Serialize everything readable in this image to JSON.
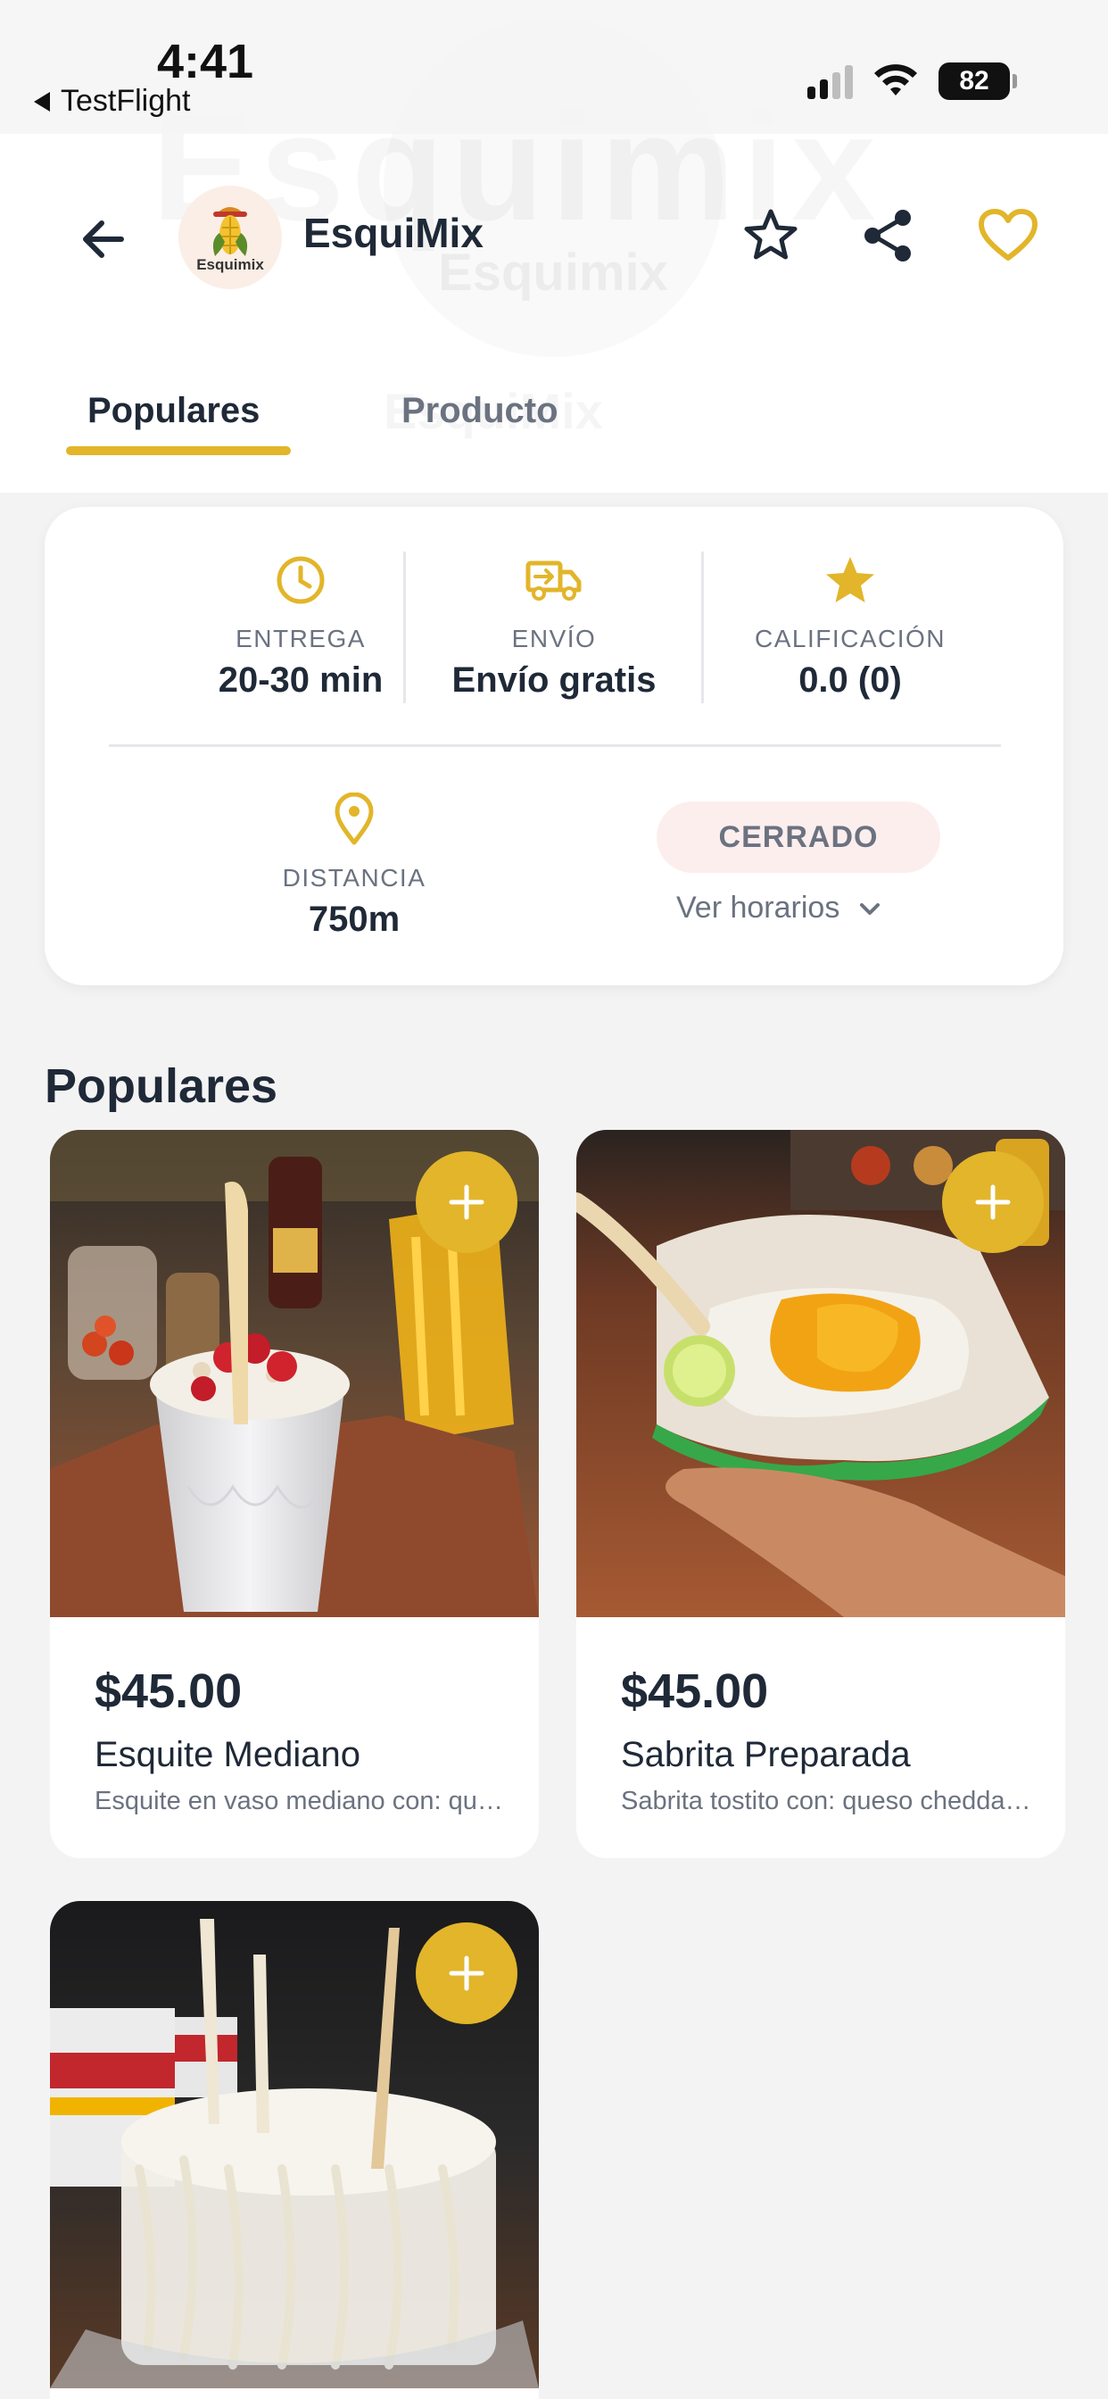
{
  "status_bar": {
    "time": "4:41",
    "back_app": "TestFlight",
    "battery": "82",
    "icons": [
      "signal-icon",
      "wifi-icon",
      "battery-icon"
    ]
  },
  "watermark": {
    "banner_word": "Esquimix",
    "logo_text": "Esquimix",
    "brand": "EsquiMix"
  },
  "header": {
    "store_name": "EsquiMix",
    "logo_text": "Esquimix",
    "icons": [
      "back-arrow-icon",
      "star-outline-icon",
      "share-icon",
      "heart-outline-icon"
    ]
  },
  "tabs": [
    {
      "label": "Populares",
      "active": true
    },
    {
      "label": "Producto",
      "active": false
    }
  ],
  "info": {
    "delivery_time": {
      "label": "ENTREGA",
      "value": "20-30 min",
      "icon": "clock-icon"
    },
    "shipping": {
      "label": "ENVÍO",
      "value": "Envío gratis",
      "icon": "delivery-truck-icon"
    },
    "rating": {
      "label": "CALIFICACIÓN",
      "value": "0.0 (0)",
      "icon": "star-filled-icon"
    },
    "distance": {
      "label": "DISTANCIA",
      "value": "750m",
      "icon": "location-pin-icon"
    },
    "status": "CERRADO",
    "hours_link": "Ver horarios"
  },
  "popular": {
    "title": "Populares",
    "products": [
      {
        "price": "$45.00",
        "name": "Esquite Mediano",
        "description": "Esquite en vaso mediano con: queso, mayonesa y chile"
      },
      {
        "price": "$45.00",
        "name": "Sabrita Preparada",
        "description": "Sabrita tostito con: queso cheddar, elote y limón"
      },
      {
        "price": "",
        "name": "",
        "description": ""
      }
    ]
  },
  "colors": {
    "accent": "#e2b52a",
    "text_primary": "#1f2937",
    "text_secondary": "#6b7280",
    "closed_badge_bg": "#fdeeee",
    "page_bg": "#f3f3f4"
  }
}
